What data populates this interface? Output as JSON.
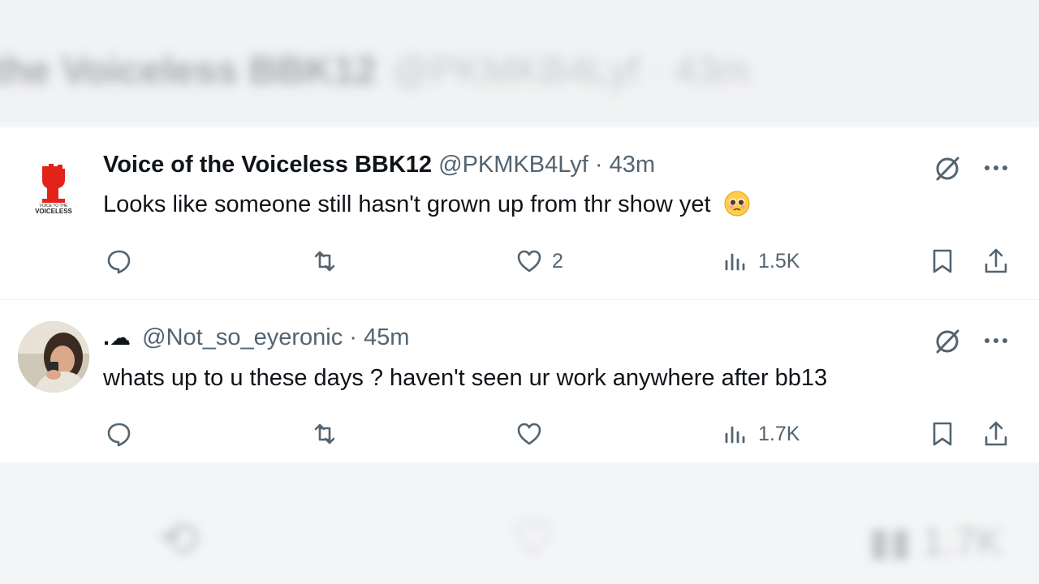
{
  "background": {
    "top_blurred_name": "the Voiceless BBK12",
    "top_blurred_meta": "@PKMKB4Lyf · 43m",
    "bottom_blurred_views": "1.7K"
  },
  "tweets": [
    {
      "display_name": "Voice of the Voiceless BBK12",
      "handle": "@PKMKB4Lyf",
      "separator": "·",
      "time": "43m",
      "text": "Looks like someone still hasn't grown up from thr show yet",
      "emoji": "pleading-face",
      "avatar_text_top": "VOICE TO THE",
      "avatar_text_bottom": "VOICELESS",
      "likes": "2",
      "views": "1.5K"
    },
    {
      "display_name": ".",
      "name_icon": "cloud",
      "handle": "@Not_so_eyeronic",
      "separator": "·",
      "time": "45m",
      "text": "whats up to u these days ? haven't seen ur work anywhere after bb13",
      "likes": "",
      "views": "1.7K"
    }
  ],
  "colors": {
    "text": "#0f1419",
    "secondary": "#536471",
    "avatar_red": "#e2231a"
  }
}
